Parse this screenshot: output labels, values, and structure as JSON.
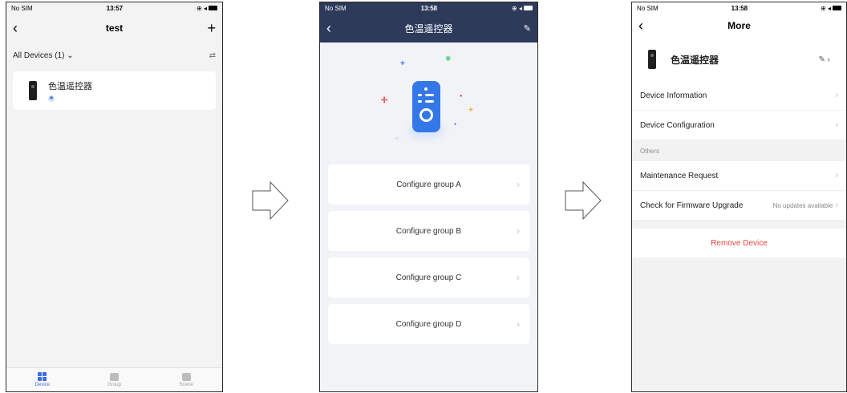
{
  "screens": [
    {
      "status": {
        "carrier": "No SIM",
        "time": "13:57",
        "icons": "⊕ ◂"
      },
      "nav": {
        "back_icon": "‹",
        "title": "test",
        "add_icon": "+"
      },
      "filter": {
        "label": "All Devices (1)",
        "chevron": "⌄",
        "toggle_icon": "⇄"
      },
      "device": {
        "name": "色温遥控器",
        "bt_icon": "✱"
      },
      "tabs": [
        {
          "label": "Device",
          "active": true
        },
        {
          "label": "Group",
          "active": false
        },
        {
          "label": "Scene",
          "active": false
        }
      ]
    },
    {
      "status": {
        "carrier": "No SIM",
        "time": "13:58",
        "icons": "⊕ ◂"
      },
      "nav": {
        "back_icon": "‹",
        "title": "色温遥控器",
        "edit_icon": "✎"
      },
      "groups": [
        "Configure group A",
        "Configure group B",
        "Configure group C",
        "Configure group D"
      ],
      "chevron": "›"
    },
    {
      "status": {
        "carrier": "No SIM",
        "time": "13:58",
        "icons": "⊕ ◂"
      },
      "nav": {
        "back_icon": "‹",
        "title": "More"
      },
      "device": {
        "name": "色温遥控器",
        "edit_icon": "✎ ›"
      },
      "rows": {
        "device_information": "Device Information",
        "device_configuration": "Device Configuration",
        "others_label": "Others",
        "maintenance_request": "Maintenance Request",
        "firmware_upgrade": "Check for Firmware Upgrade",
        "firmware_status": "No updates available",
        "remove_device": "Remove Device"
      },
      "chevron": "›"
    }
  ],
  "colors": {
    "accent_blue": "#3a6de0",
    "header_navy": "#2d3a5a",
    "danger_red": "#e8453c"
  }
}
